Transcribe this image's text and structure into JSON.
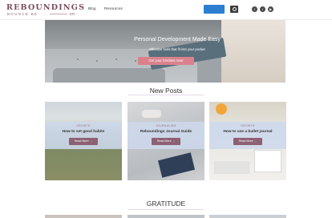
{
  "header": {
    "logo_main": "REBOUNDINGS",
    "logo_sub": "BOUNCE BE",
    "logo_sub2": "ER",
    "nav": [
      "Blog",
      "Resources"
    ],
    "social_icons": [
      "facebook-icon",
      "twitter-icon",
      "youtube-icon"
    ],
    "accent_color": "#2b7fd1"
  },
  "hero": {
    "title": "Personal Development Made Easy",
    "subtitle": "Effective tools that fit into your pocket",
    "cta_label": "Get your freebies now!",
    "cta_color": "#d9828e"
  },
  "sections": {
    "new_posts": "New Posts",
    "gratitude": "GRATITUDE"
  },
  "posts": [
    {
      "category": "GROWTH",
      "title": "How to set good habits",
      "button": "Read More →"
    },
    {
      "category": "JOURNALING",
      "title": "Reboundings Journal Guide",
      "button": "Read More →"
    },
    {
      "category": "GROWTH",
      "title": "How to use a bullet journal",
      "button": "Read More →"
    }
  ],
  "brand_color": "#7a4b5e",
  "button_color": "#8c6173"
}
